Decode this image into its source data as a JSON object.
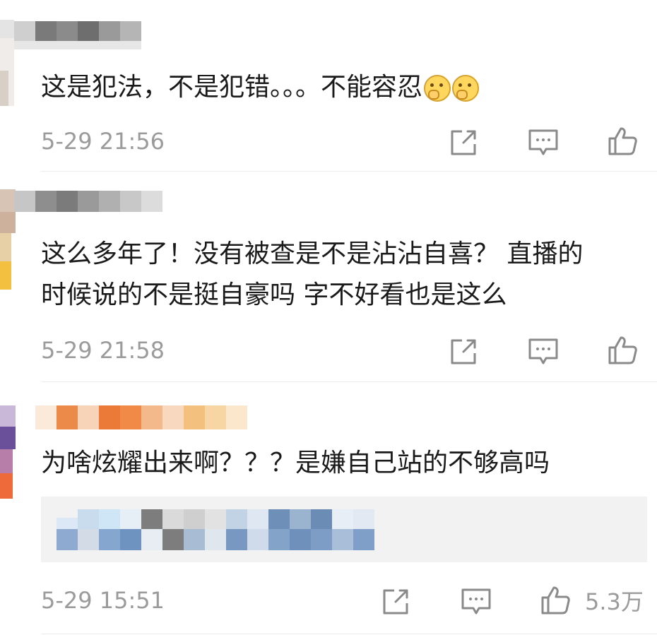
{
  "comments": [
    {
      "text": "这是犯法，不是犯错。。。不能容忍",
      "emoji": [
        "hug-emoji",
        "hug-emoji"
      ],
      "time": "5-29 21:56",
      "like_count": ""
    },
    {
      "text_line1": "这么多年了！没有被查是不是沾沾自喜？ 直播的",
      "text_line2": "时候说的不是挺自豪吗 字不好看也是这么",
      "time": "5-29 21:58",
      "like_count": ""
    },
    {
      "text": "为啥炫耀出来啊？？？是嫌自己站的不够高吗",
      "time": "5-29 15:51",
      "like_count": "5.3万",
      "has_reply_box": true
    }
  ],
  "icons": {
    "share": "share-icon",
    "comment": "comment-icon",
    "like": "thumbs-up-icon"
  },
  "colors": {
    "text": "#1a1a1a",
    "meta": "#9b9b9b",
    "reply_bg": "#f2f2f2"
  }
}
